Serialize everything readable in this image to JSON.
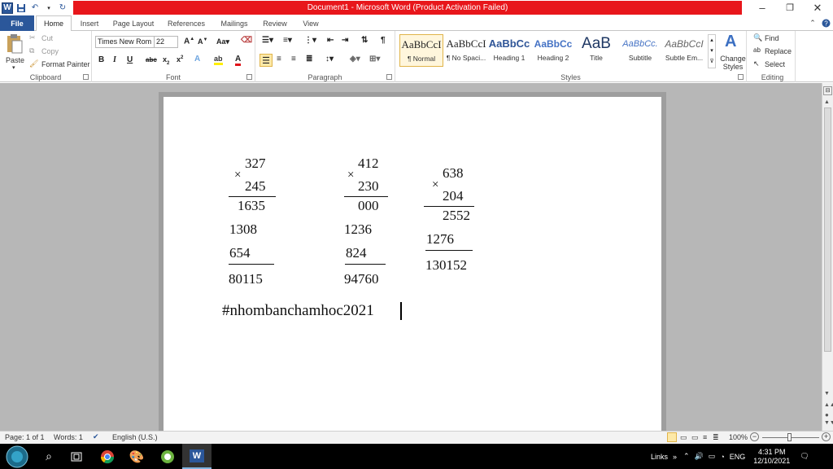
{
  "window": {
    "title": "Document1 - Microsoft Word (Product Activation Failed)",
    "minimize": "–",
    "restore": "❐",
    "close": "✕"
  },
  "tabs": [
    "File",
    "Home",
    "Insert",
    "Page Layout",
    "References",
    "Mailings",
    "Review",
    "View"
  ],
  "active_tab": "Home",
  "ribbon": {
    "clipboard": {
      "paste": "Paste",
      "cut": "Cut",
      "copy": "Copy",
      "format_painter": "Format Painter",
      "label": "Clipboard"
    },
    "font": {
      "name": "Times New Rom",
      "size": "22",
      "label": "Font"
    },
    "paragraph": {
      "label": "Paragraph"
    },
    "styles": {
      "label": "Styles",
      "items": [
        {
          "sample": "AaBbCcI",
          "name": "¶ Normal"
        },
        {
          "sample": "AaBbCcI",
          "name": "¶ No Spaci..."
        },
        {
          "sample": "AaBbCc",
          "name": "Heading 1"
        },
        {
          "sample": "AaBbCc",
          "name": "Heading 2"
        },
        {
          "sample": "AaB",
          "name": "Title"
        },
        {
          "sample": "AaBbCc.",
          "name": "Subtitle"
        },
        {
          "sample": "AaBbCcI",
          "name": "Subtle Em..."
        }
      ],
      "change_styles": "Change Styles"
    },
    "editing": {
      "find": "Find",
      "replace": "Replace",
      "select": "Select",
      "label": "Editing"
    }
  },
  "document": {
    "mult1": {
      "a": "327",
      "op": "×",
      "b": "245",
      "p1": "1635",
      "p2": "1308",
      "p3": "654",
      "result": "80115"
    },
    "mult2": {
      "a": "412",
      "op": "×",
      "b": "230",
      "p1": "000",
      "p2": "1236",
      "p3": "824",
      "result": "94760"
    },
    "mult3": {
      "a": "638",
      "op": "×",
      "b": "204",
      "p1": "2552",
      "p2": "1276",
      "result": "130152"
    },
    "hashtag": "#nhombanchamhoc2021"
  },
  "status": {
    "page": "Page: 1 of 1",
    "words": "Words: 1",
    "language": "English (U.S.)",
    "zoom": "100%"
  },
  "taskbar": {
    "links": "Links",
    "lang": "ENG",
    "time": "4:31 PM",
    "date": "12/10/2021"
  },
  "colors": {
    "title_bar": "#e8161b",
    "file_tab": "#2b579a",
    "workspace": "#b7b7b7"
  }
}
